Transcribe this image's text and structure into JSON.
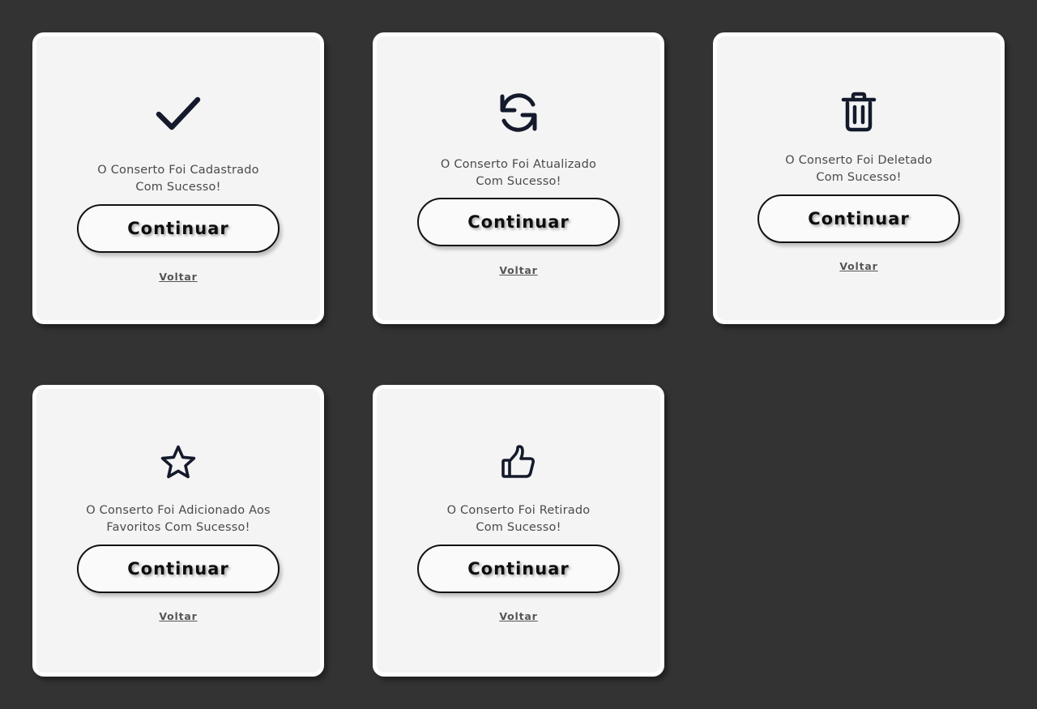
{
  "cards": [
    {
      "icon": "checkmark-icon",
      "message_line1": "O Conserto Foi Cadastrado",
      "message_line2": "Com Sucesso!",
      "continue_label": "Continuar",
      "back_label": "Voltar"
    },
    {
      "icon": "refresh-icon",
      "message_line1": "O Conserto Foi Atualizado",
      "message_line2": "Com Sucesso!",
      "continue_label": "Continuar",
      "back_label": "Voltar"
    },
    {
      "icon": "trash-icon",
      "message_line1": "O Conserto Foi Deletado",
      "message_line2": "Com Sucesso!",
      "continue_label": "Continuar",
      "back_label": "Voltar"
    },
    {
      "icon": "star-icon",
      "message_line1": "O Conserto Foi Adicionado Aos",
      "message_line2": "Favoritos Com Sucesso!",
      "continue_label": "Continuar",
      "back_label": "Voltar"
    },
    {
      "icon": "thumbs-up-icon",
      "message_line1": "O Conserto Foi Retirado",
      "message_line2": "Com Sucesso!",
      "continue_label": "Continuar",
      "back_label": "Voltar"
    }
  ],
  "colors": {
    "page_background": "#333333",
    "card_background": "#f4f4f4",
    "icon": "#141a2b",
    "button_border": "#111111"
  }
}
